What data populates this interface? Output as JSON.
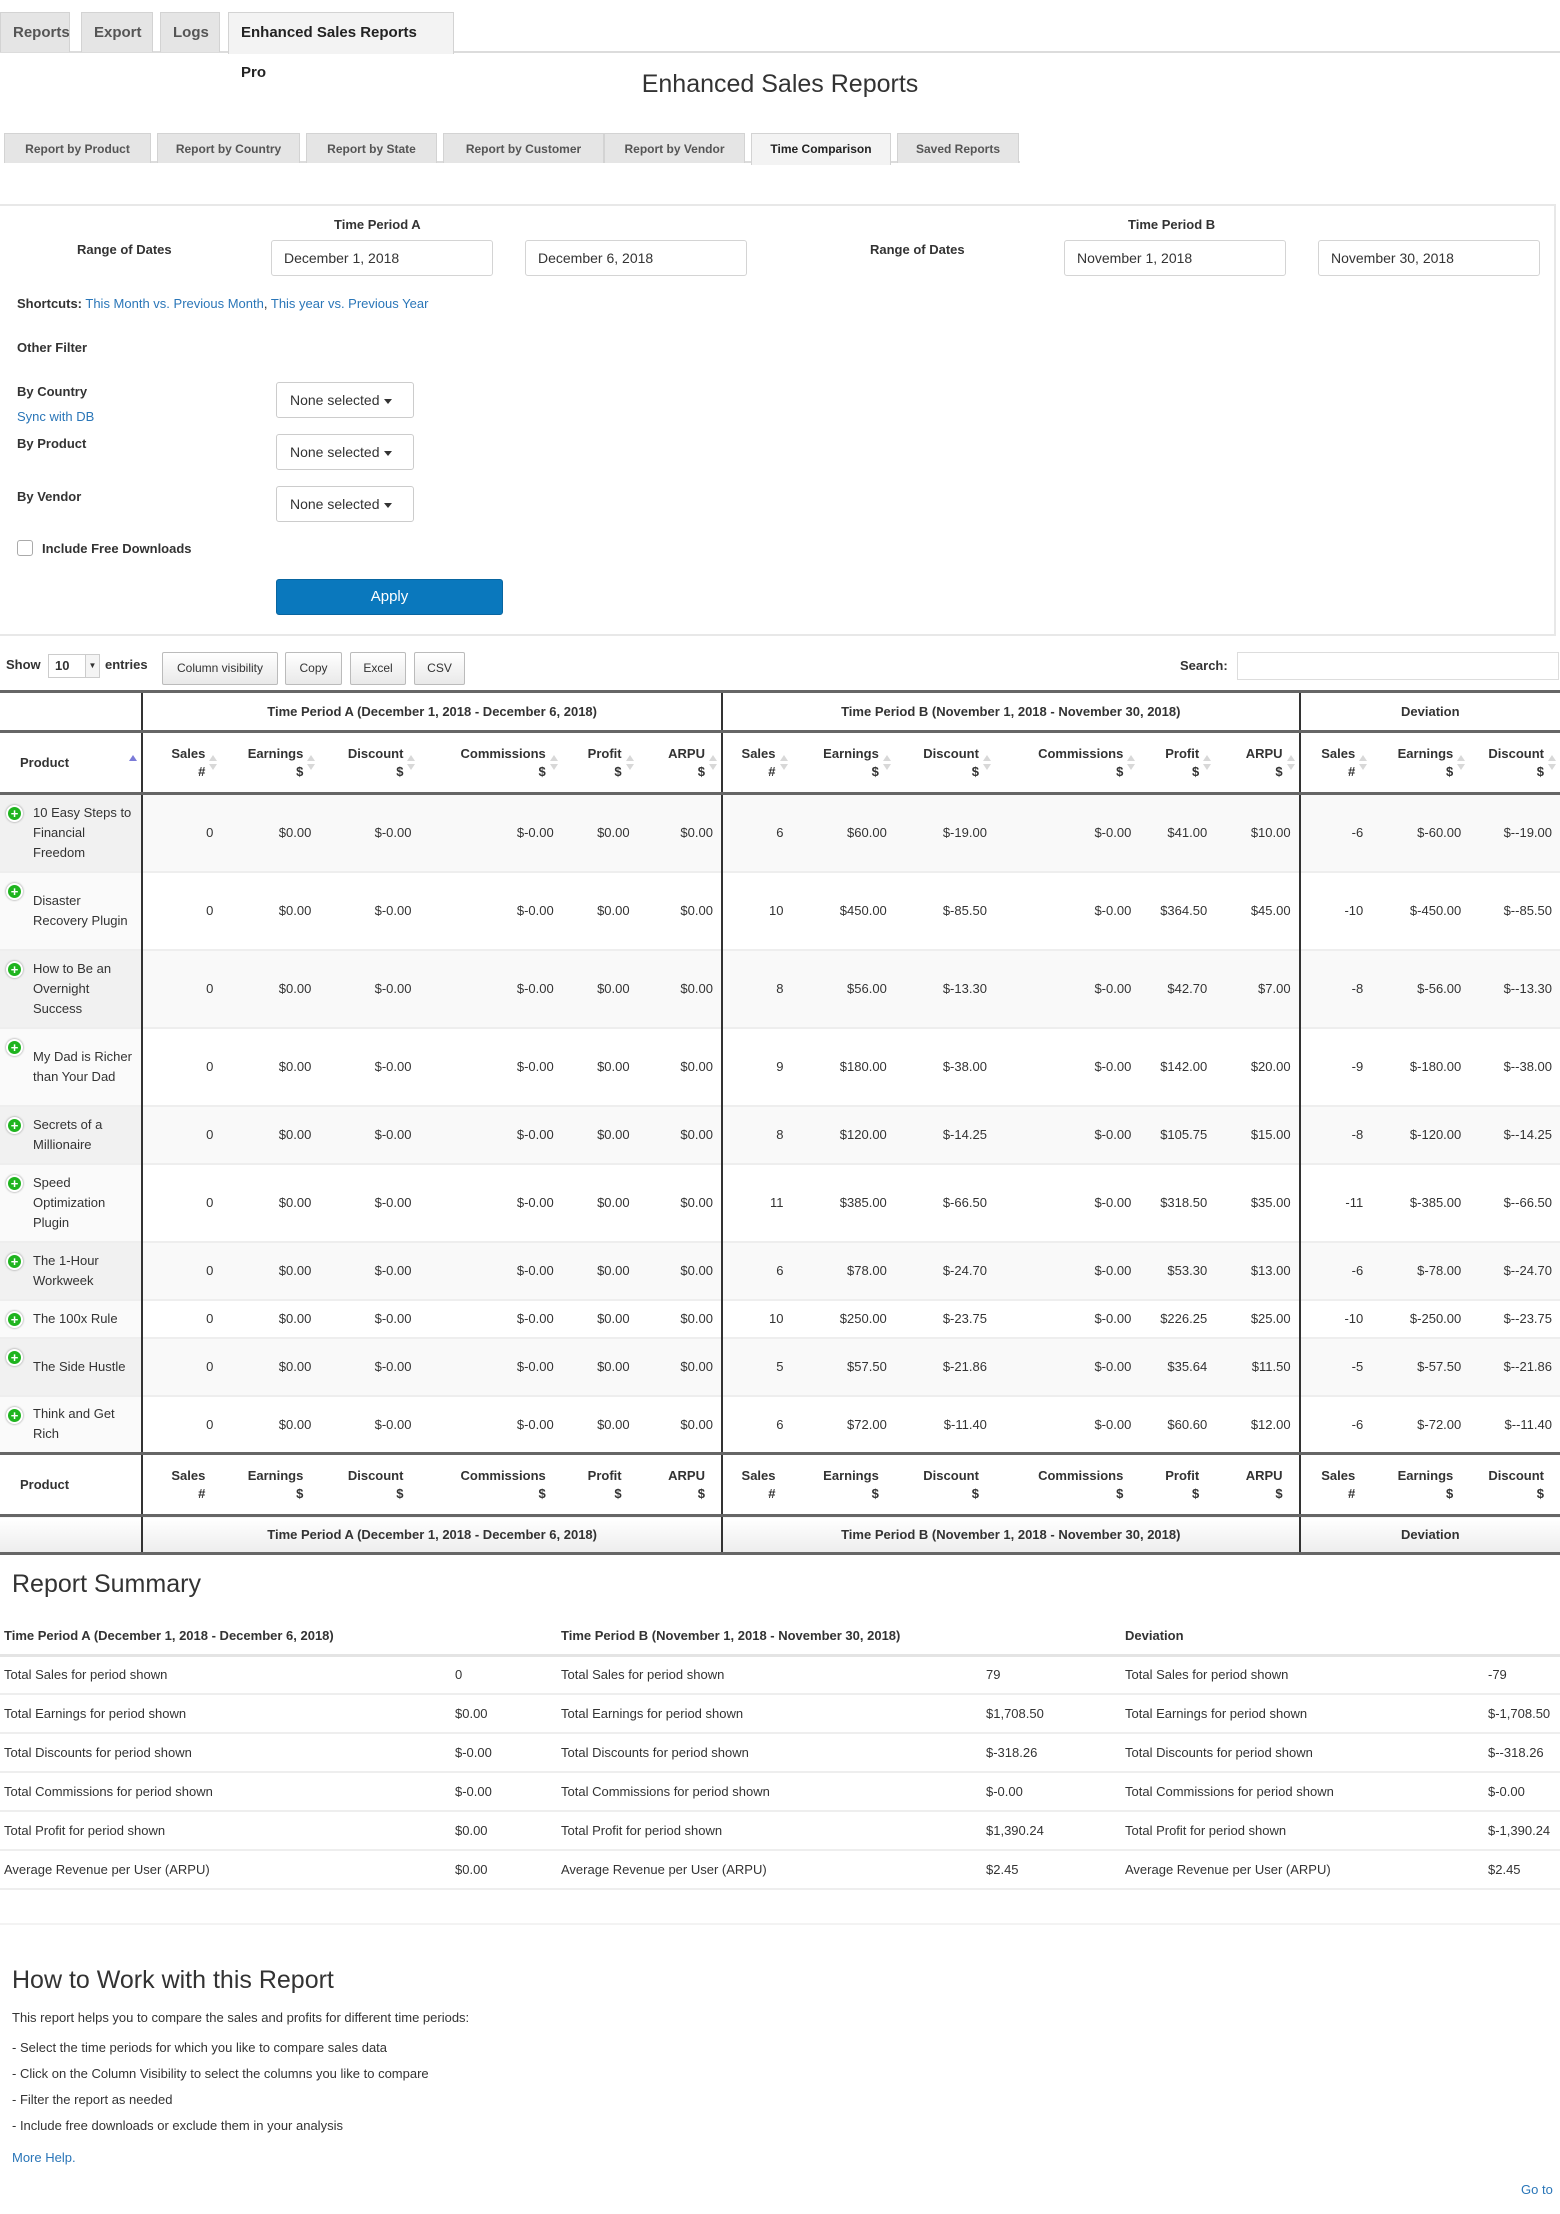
{
  "top_tabs": [
    {
      "label": "Reports",
      "active": false
    },
    {
      "label": "Export",
      "active": false
    },
    {
      "label": "Logs",
      "active": false
    },
    {
      "label": "Enhanced Sales Reports Pro",
      "active": true
    }
  ],
  "page_title": "Enhanced Sales Reports",
  "report_tabs": [
    {
      "label": "Report by Product",
      "active": false
    },
    {
      "label": "Report by Country",
      "active": false
    },
    {
      "label": "Report by State",
      "active": false
    },
    {
      "label": "Report by Customer",
      "active": false
    },
    {
      "label": "Report by Vendor",
      "active": false
    },
    {
      "label": "Time Comparison",
      "active": true
    },
    {
      "label": "Saved Reports",
      "active": false
    }
  ],
  "filters": {
    "period_a": {
      "title": "Time Period A",
      "range_label": "Range of Dates",
      "start": "December 1, 2018",
      "end": "December 6, 2018"
    },
    "period_b": {
      "title": "Time Period B",
      "range_label": "Range of Dates",
      "start": "November 1, 2018",
      "end": "November 30, 2018"
    },
    "shortcuts_label": "Shortcuts:",
    "shortcut_1": "This Month vs. Previous Month",
    "shortcut_sep": ",",
    "shortcut_2": "This year vs. Previous Year",
    "other_filter": "Other Filter",
    "by_country": "By Country",
    "sync_db": "Sync with DB",
    "by_product": "By Product",
    "by_vendor": "By Vendor",
    "country_value": "None selected",
    "product_value": "None selected",
    "vendor_value": "None selected",
    "include_free": "Include Free Downloads",
    "include_free_checked": false,
    "apply": "Apply"
  },
  "toolbar": {
    "show": "Show",
    "entries_value": "10",
    "entries": "entries",
    "buttons": [
      "Column visibility",
      "Copy",
      "Excel",
      "CSV"
    ],
    "search_label": "Search:",
    "search_value": ""
  },
  "table": {
    "group_headers": {
      "a": "Time Period A (December 1, 2018 - December 6, 2018)",
      "b": "Time Period B (November 1, 2018 - November 30, 2018)",
      "dev": "Deviation"
    },
    "product_header": "Product",
    "column_headers": [
      {
        "name": "Sales",
        "unit": "#"
      },
      {
        "name": "Earnings",
        "unit": "$"
      },
      {
        "name": "Discount",
        "unit": "$"
      },
      {
        "name": "Commissions",
        "unit": "$"
      },
      {
        "name": "Profit",
        "unit": "$"
      },
      {
        "name": "ARPU",
        "unit": "$"
      },
      {
        "name": "Sales",
        "unit": "#"
      },
      {
        "name": "Earnings",
        "unit": "$"
      },
      {
        "name": "Discount",
        "unit": "$"
      },
      {
        "name": "Commissions",
        "unit": "$"
      },
      {
        "name": "Profit",
        "unit": "$"
      },
      {
        "name": "ARPU",
        "unit": "$"
      },
      {
        "name": "Sales",
        "unit": "#"
      },
      {
        "name": "Earnings",
        "unit": "$"
      },
      {
        "name": "Discount",
        "unit": "$"
      }
    ],
    "rows": [
      {
        "product": "10 Easy Steps to Financial Freedom",
        "cells": [
          "0",
          "$0.00",
          "$-0.00",
          "$-0.00",
          "$0.00",
          "$0.00",
          "6",
          "$60.00",
          "$-19.00",
          "$-0.00",
          "$41.00",
          "$10.00",
          "-6",
          "$-60.00",
          "$--19.00"
        ]
      },
      {
        "product": "Disaster Recovery Plugin",
        "cells": [
          "0",
          "$0.00",
          "$-0.00",
          "$-0.00",
          "$0.00",
          "$0.00",
          "10",
          "$450.00",
          "$-85.50",
          "$-0.00",
          "$364.50",
          "$45.00",
          "-10",
          "$-450.00",
          "$--85.50"
        ]
      },
      {
        "product": "How to Be an Overnight Success",
        "cells": [
          "0",
          "$0.00",
          "$-0.00",
          "$-0.00",
          "$0.00",
          "$0.00",
          "8",
          "$56.00",
          "$-13.30",
          "$-0.00",
          "$42.70",
          "$7.00",
          "-8",
          "$-56.00",
          "$--13.30"
        ]
      },
      {
        "product": "My Dad is Richer than Your Dad",
        "cells": [
          "0",
          "$0.00",
          "$-0.00",
          "$-0.00",
          "$0.00",
          "$0.00",
          "9",
          "$180.00",
          "$-38.00",
          "$-0.00",
          "$142.00",
          "$20.00",
          "-9",
          "$-180.00",
          "$--38.00"
        ]
      },
      {
        "product": "Secrets of a Millionaire",
        "cells": [
          "0",
          "$0.00",
          "$-0.00",
          "$-0.00",
          "$0.00",
          "$0.00",
          "8",
          "$120.00",
          "$-14.25",
          "$-0.00",
          "$105.75",
          "$15.00",
          "-8",
          "$-120.00",
          "$--14.25"
        ]
      },
      {
        "product": "Speed Optimization Plugin",
        "cells": [
          "0",
          "$0.00",
          "$-0.00",
          "$-0.00",
          "$0.00",
          "$0.00",
          "11",
          "$385.00",
          "$-66.50",
          "$-0.00",
          "$318.50",
          "$35.00",
          "-11",
          "$-385.00",
          "$--66.50"
        ]
      },
      {
        "product": "The 1-Hour Workweek",
        "cells": [
          "0",
          "$0.00",
          "$-0.00",
          "$-0.00",
          "$0.00",
          "$0.00",
          "6",
          "$78.00",
          "$-24.70",
          "$-0.00",
          "$53.30",
          "$13.00",
          "-6",
          "$-78.00",
          "$--24.70"
        ]
      },
      {
        "product": "The 100x Rule",
        "cells": [
          "0",
          "$0.00",
          "$-0.00",
          "$-0.00",
          "$0.00",
          "$0.00",
          "10",
          "$250.00",
          "$-23.75",
          "$-0.00",
          "$226.25",
          "$25.00",
          "-10",
          "$-250.00",
          "$--23.75"
        ]
      },
      {
        "product": "The Side Hustle",
        "cells": [
          "0",
          "$0.00",
          "$-0.00",
          "$-0.00",
          "$0.00",
          "$0.00",
          "5",
          "$57.50",
          "$-21.86",
          "$-0.00",
          "$35.64",
          "$11.50",
          "-5",
          "$-57.50",
          "$--21.86"
        ]
      },
      {
        "product": "Think and Get Rich",
        "cells": [
          "0",
          "$0.00",
          "$-0.00",
          "$-0.00",
          "$0.00",
          "$0.00",
          "6",
          "$72.00",
          "$-11.40",
          "$-0.00",
          "$60.60",
          "$12.00",
          "-6",
          "$-72.00",
          "$--11.40"
        ]
      }
    ]
  },
  "summary": {
    "title": "Report Summary",
    "headers": {
      "a": "Time Period A (December 1, 2018 - December 6, 2018)",
      "b": "Time Period B (November 1, 2018 - November 30, 2018)",
      "dev": "Deviation"
    },
    "rows": [
      {
        "label": "Total Sales for period shown",
        "a": "0",
        "b": "79",
        "dev": "-79"
      },
      {
        "label": "Total Earnings for period shown",
        "a": "$0.00",
        "b": "$1,708.50",
        "dev": "$-1,708.50"
      },
      {
        "label": "Total Discounts for period shown",
        "a": "$-0.00",
        "b": "$-318.26",
        "dev": "$--318.26"
      },
      {
        "label": "Total Commissions for period shown",
        "a": "$-0.00",
        "b": "$-0.00",
        "dev": "$-0.00"
      },
      {
        "label": "Total Profit for period shown",
        "a": "$0.00",
        "b": "$1,390.24",
        "dev": "$-1,390.24"
      },
      {
        "label": "Average Revenue per User (ARPU)",
        "a": "$0.00",
        "b": "$2.45",
        "dev": "$2.45"
      }
    ]
  },
  "howto": {
    "title": "How to Work with this Report",
    "intro": "This report helps you to compare the sales and profits for different time periods:",
    "steps": [
      "- Select the time periods for which you like to compare sales data",
      "- Click on the Column Visibility to select the columns you like to compare",
      "- Filter the report as needed",
      "- Include free downloads or exclude them in your analysis"
    ],
    "more_help": "More Help.",
    "goto": "Go to"
  }
}
